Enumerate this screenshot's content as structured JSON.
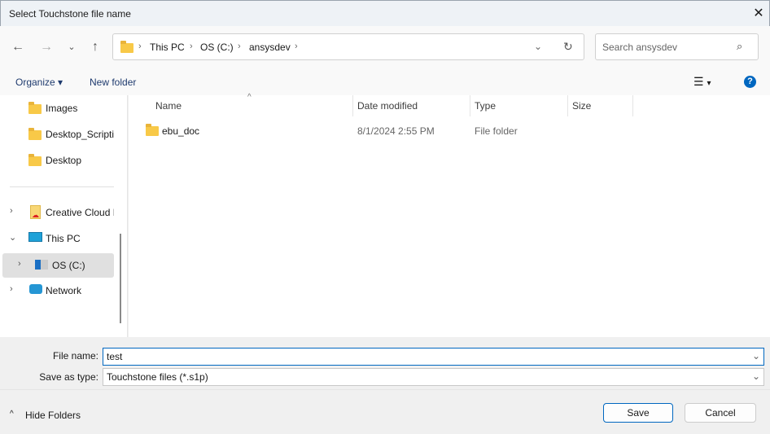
{
  "window": {
    "title": "Select Touchstone file name"
  },
  "nav": {
    "breadcrumbs": [
      "This PC",
      "OS (C:)",
      "ansysdev"
    ],
    "search_placeholder": "Search ansysdev"
  },
  "toolbar": {
    "organize": "Organize",
    "new_folder": "New folder"
  },
  "sidebar": {
    "items": [
      {
        "label": "Images"
      },
      {
        "label": "Desktop_Scripting"
      },
      {
        "label": "Desktop"
      },
      {
        "label": "Creative Cloud Files"
      },
      {
        "label": "This PC"
      },
      {
        "label": "OS (C:)"
      },
      {
        "label": "Network"
      }
    ]
  },
  "columns": {
    "name": "Name",
    "date": "Date modified",
    "type": "Type",
    "size": "Size"
  },
  "files": [
    {
      "name": "ebu_doc",
      "date": "8/1/2024 2:55 PM",
      "type": "File folder",
      "size": ""
    }
  ],
  "form": {
    "file_name_label": "File name:",
    "file_name": "test",
    "type_label": "Save as type:",
    "type_value": "Touchstone files (*.s1p)"
  },
  "footer": {
    "hide_folders": "Hide Folders",
    "save": "Save",
    "cancel": "Cancel"
  },
  "colors": {
    "accent": "#0067c0",
    "selected": "#e0e0e0"
  }
}
